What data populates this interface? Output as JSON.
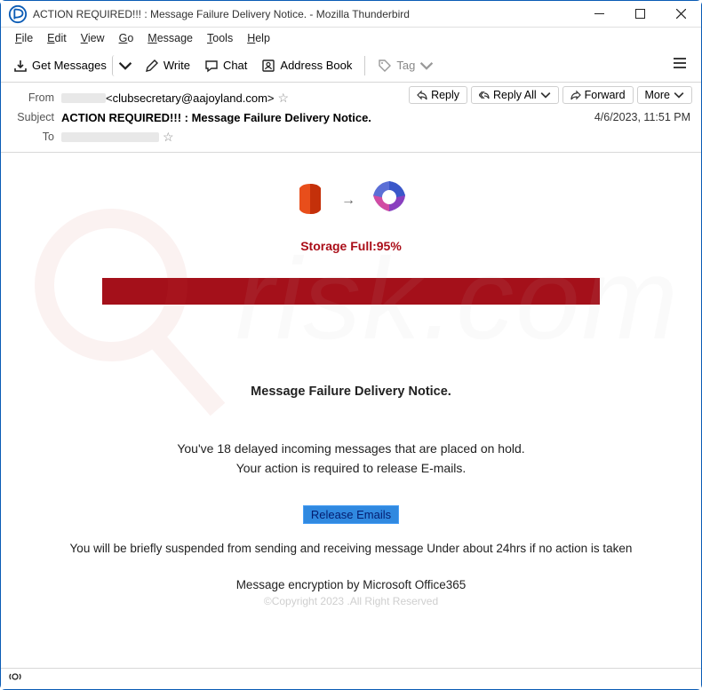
{
  "window": {
    "title": "ACTION REQUIRED!!! : Message Failure Delivery Notice. - Mozilla Thunderbird"
  },
  "menubar": {
    "file": "File",
    "edit": "Edit",
    "view": "View",
    "go": "Go",
    "message": "Message",
    "tools": "Tools",
    "help": "Help"
  },
  "toolbar": {
    "get": "Get Messages",
    "write": "Write",
    "chat": "Chat",
    "address": "Address Book",
    "tag": "Tag"
  },
  "header": {
    "from_label": "From",
    "from_addr": " <clubsecretary@aajoyland.com>",
    "subject_label": "Subject",
    "subject": "ACTION REQUIRED!!! : Message Failure Delivery Notice.",
    "to_label": "To",
    "date": "4/6/2023, 11:51 PM"
  },
  "actions": {
    "reply": "Reply",
    "replyall": "Reply All",
    "forward": "Forward",
    "more": "More"
  },
  "body": {
    "storage": "Storage Full:95%",
    "notice_title": "Message Failure Delivery Notice.",
    "line1": "You've 18 delayed incoming messages that are placed on hold.",
    "line2": "Your action is required to release E-mails.",
    "release_btn": "Release Emails",
    "suspend": "You will be briefly suspended from sending and receiving message Under about 24hrs if no action is taken",
    "encrypt": "Message encryption by Microsoft Office365",
    "copyright": "©Copyright 2023 .All Right Reserved"
  }
}
